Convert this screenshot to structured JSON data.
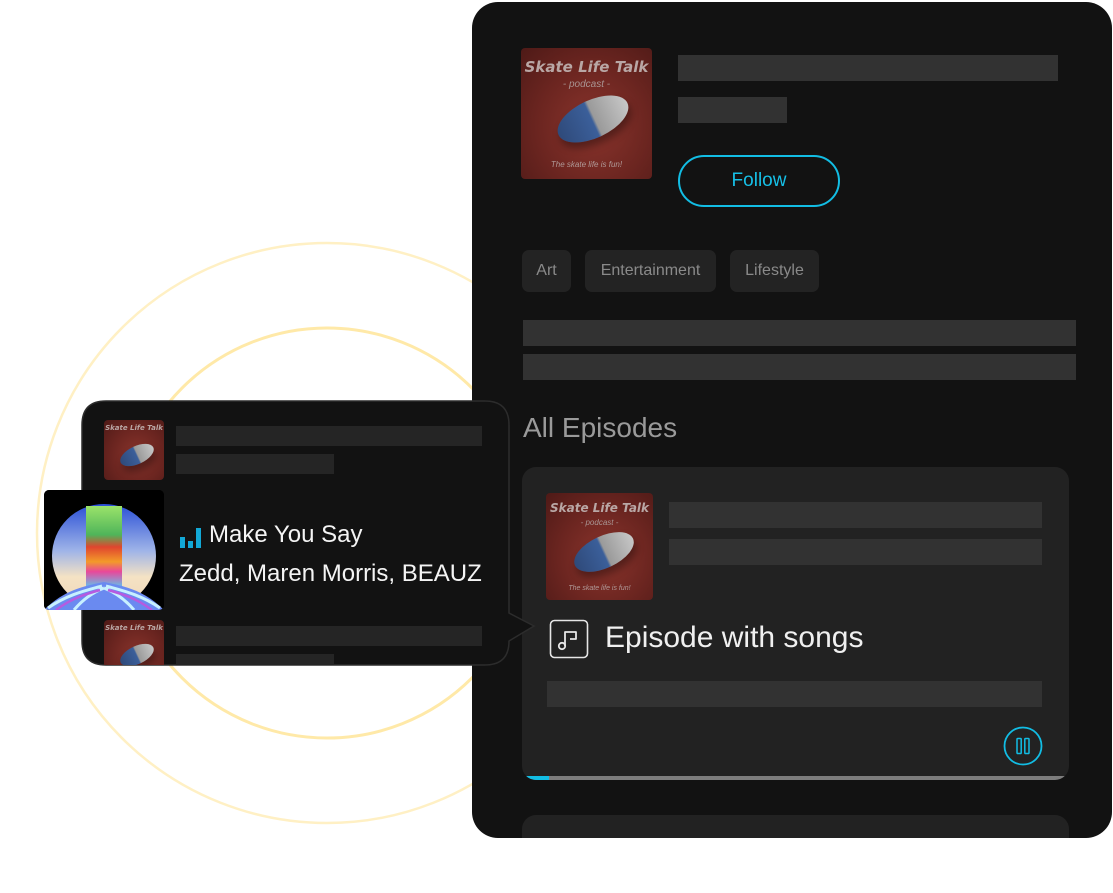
{
  "podcast": {
    "cover": {
      "title": "Skate Life Talk",
      "subtitle": "- podcast -",
      "tagline": "The skate life is fun!"
    },
    "follow_label": "Follow",
    "categories": [
      "Art",
      "Entertainment",
      "Lifestyle"
    ]
  },
  "episodes": {
    "section_title": "All Episodes",
    "current": {
      "badge_label": "Episode with songs",
      "badge_icon": "music-note-icon",
      "play_state": "paused-button-shown",
      "progress_fraction": 0.05
    }
  },
  "song_callout": {
    "now_playing_icon": "equalizer-icon",
    "song_title": "Make You Say",
    "artists": "Zedd, Maren Morris, BEAUZ"
  },
  "colors": {
    "accent": "#12bde4",
    "panel_bg": "#121212",
    "card_bg": "#222222",
    "placeholder": "#323232",
    "ring": "#ffd24a"
  }
}
